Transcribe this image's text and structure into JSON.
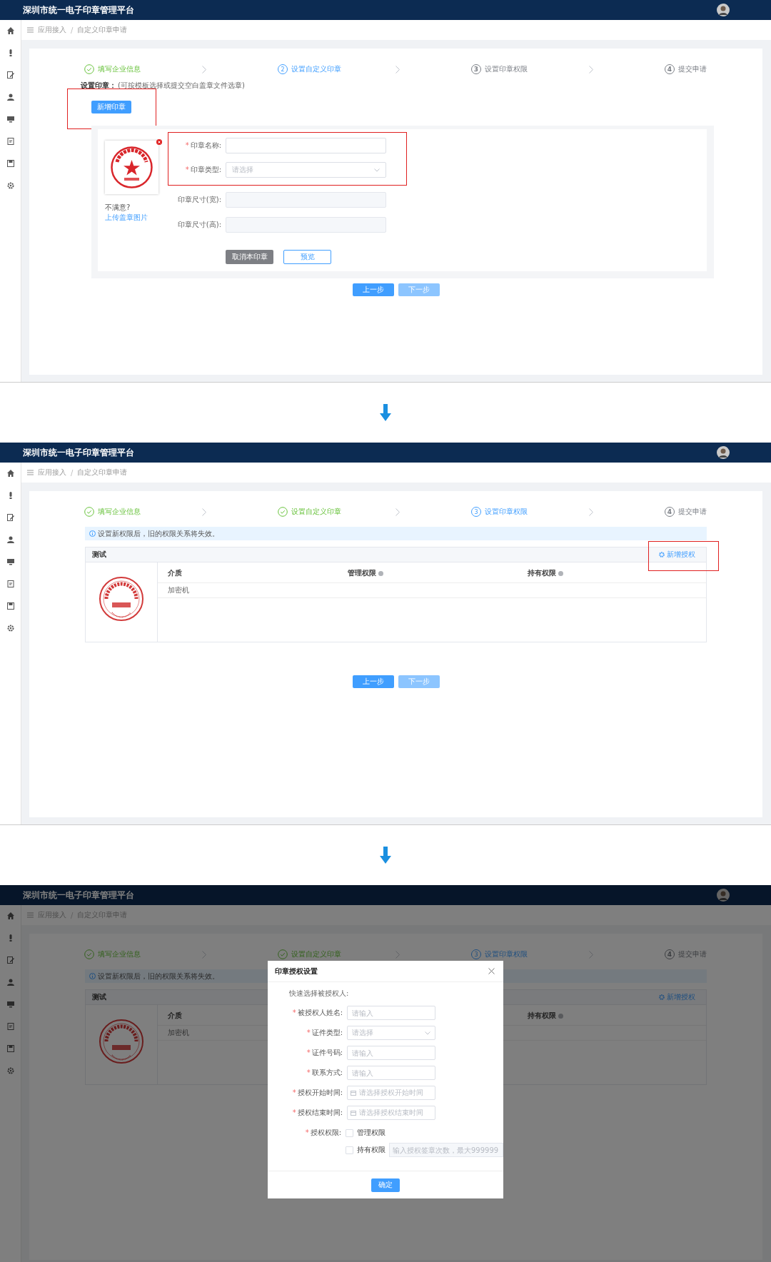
{
  "panels": [
    {
      "kind": "seal_form",
      "app_title": "深圳市统一电子印章管理平台",
      "breadcrumb": {
        "items": [
          "应用接入",
          "自定义印章申请"
        ],
        "separator": "/"
      },
      "steps": [
        {
          "label": "填写企业信息",
          "completed": true,
          "selected": false
        },
        {
          "label": "设置自定义印章",
          "number": "2",
          "completed": false,
          "selected": true
        },
        {
          "label": "设置印章权限",
          "number": "3",
          "completed": false,
          "selected": false
        },
        {
          "label": "提交申请",
          "number": "4",
          "completed": false,
          "selected": false
        }
      ],
      "section": {
        "label": "设置印章：",
        "hint": "(可按模板选择或提交空白盖章文件选章)"
      },
      "add_button": {
        "label": "新增印章",
        "highlighted": true
      },
      "seal_note": {
        "text": "不满意?",
        "link": "上传盖章图片"
      },
      "fields": [
        {
          "mark": "*",
          "label": "印章名称:",
          "kind": "text",
          "highlighted": true
        },
        {
          "mark": "*",
          "label": "印章类型:",
          "kind": "select",
          "placeholder": "请选择",
          "highlighted": true
        },
        {
          "label": "印章尺寸(宽):",
          "kind": "readonly",
          "highlighted": false
        },
        {
          "label": "印章尺寸(高):",
          "kind": "readonly",
          "highlighted": false
        }
      ],
      "form_buttons": [
        {
          "label": "取消本印章",
          "kind": "secondary"
        },
        {
          "label": "预览",
          "kind": "outline"
        }
      ],
      "nav_buttons": [
        {
          "label": "上一步",
          "disabled": false
        },
        {
          "label": "下一步",
          "disabled": true
        }
      ]
    },
    {
      "kind": "permissions",
      "app_title": "深圳市统一电子印章管理平台",
      "breadcrumb": {
        "items": [
          "应用接入",
          "自定义印章申请"
        ],
        "separator": "/"
      },
      "steps": [
        {
          "label": "填写企业信息",
          "completed": true,
          "selected": false
        },
        {
          "label": "设置自定义印章",
          "completed": true,
          "selected": false
        },
        {
          "label": "设置印章权限",
          "number": "3",
          "completed": false,
          "selected": true
        },
        {
          "label": "提交申请",
          "number": "4",
          "completed": false,
          "selected": false
        }
      ],
      "notice": "设置新权限后，旧的权限关系将失效。",
      "seal_card": {
        "title": "测试",
        "add_button": {
          "label": "新增授权",
          "highlighted": true
        },
        "columns": [
          {
            "label": "介质"
          },
          {
            "label": "管理权限",
            "hint": true
          },
          {
            "label": "持有权限",
            "hint": true
          }
        ],
        "rows": [
          [
            "加密机"
          ]
        ]
      },
      "nav_buttons": [
        {
          "label": "上一步",
          "disabled": false
        },
        {
          "label": "下一步",
          "disabled": true
        }
      ]
    },
    {
      "kind": "permissions",
      "app_title": "深圳市统一电子印章管理平台",
      "breadcrumb": {
        "items": [
          "应用接入",
          "自定义印章申请"
        ],
        "separator": "/"
      },
      "steps": [
        {
          "label": "填写企业信息",
          "completed": true,
          "selected": false
        },
        {
          "label": "设置自定义印章",
          "completed": true,
          "selected": false
        },
        {
          "label": "设置印章权限",
          "number": "3",
          "completed": false,
          "selected": true
        },
        {
          "label": "提交申请",
          "number": "4",
          "completed": false,
          "selected": false
        }
      ],
      "notice": "设置新权限后，旧的权限关系将失效。",
      "seal_card": {
        "title": "测试",
        "add_button": {
          "label": "新增授权"
        },
        "columns": [
          {
            "label": "介质"
          },
          {
            "label": "持有权限",
            "hint": true
          }
        ],
        "rows": [
          [
            "加密机"
          ]
        ]
      },
      "modal": {
        "title": "印章授权设置",
        "quick_select": "快速选择被授权人:",
        "fields": [
          {
            "mark": "*",
            "label": "被授权人姓名:",
            "kind": "text",
            "placeholder": "请输入"
          },
          {
            "mark": "*",
            "label": "证件类型:",
            "kind": "select",
            "placeholder": "请选择"
          },
          {
            "mark": "*",
            "label": "证件号码:",
            "kind": "text",
            "placeholder": "请输入"
          },
          {
            "mark": "*",
            "label": "联系方式:",
            "kind": "text",
            "placeholder": "请输入"
          },
          {
            "mark": "*",
            "label": "授权开始时间:",
            "kind": "date",
            "placeholder": "请选择授权开始时间"
          },
          {
            "mark": "*",
            "label": "授权结束时间:",
            "kind": "date",
            "placeholder": "请选择授权结束时间"
          },
          {
            "mark": "*",
            "label": "授权权限:",
            "kind": "checks",
            "options": [
              {
                "label": "管理权限",
                "checked": false
              },
              {
                "label": "持有权限",
                "checked": false,
                "placeholder": "输入授权签章次数，最大999999"
              }
            ]
          }
        ],
        "confirm": "确定"
      }
    }
  ]
}
